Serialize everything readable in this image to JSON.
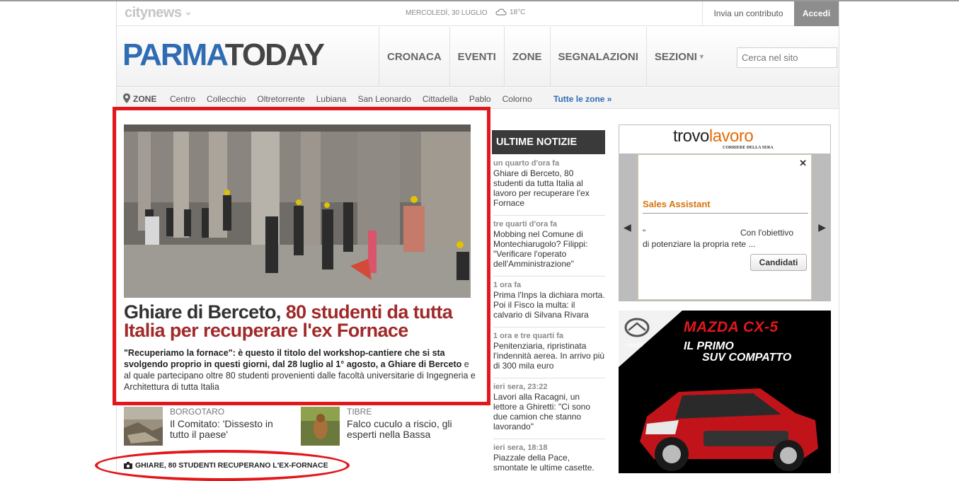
{
  "topbar": {
    "brand": "citynews",
    "date": "MERCOLEDÌ, 30 LUGLIO",
    "temperature": "18°C",
    "contribute_label": "Invia un contributo",
    "login_label": "Accedi"
  },
  "header": {
    "logo_part1": "PARMA",
    "logo_part2": "TODAY",
    "nav": [
      {
        "label": "CRONACA"
      },
      {
        "label": "EVENTI"
      },
      {
        "label": "ZONE"
      },
      {
        "label": "SEGNALAZIONI"
      },
      {
        "label": "SEZIONI"
      }
    ],
    "search_placeholder": "Cerca nel sito"
  },
  "zones": {
    "label": "ZONE",
    "items": [
      "Centro",
      "Collecchio",
      "Oltretorrente",
      "Lubiana",
      "San Leonardo",
      "Cittadella",
      "Pablo",
      "Colorno"
    ],
    "all_label": "Tutte le zone »"
  },
  "lead": {
    "headline_part1": "Ghiare di Berceto, ",
    "headline_part2": "80 studenti da tutta Italia per recuperare l'ex Fornace",
    "abstract_bold": "\"Recuperiamo la fornace\": è questo il titolo del workshop-cantiere che si sta svolgendo proprio in questi giorni, dal 28 luglio al 1° agosto, a Ghiare di Berceto",
    "abstract_rest": " e al quale partecipano oltre 80 studenti provenienti dalle facoltà universitarie di Ingegneria e Architettura di tutta Italia"
  },
  "stories": [
    {
      "category": "BORGOTARO",
      "title": "Il Comitato: 'Dissesto in tutto il paese'"
    },
    {
      "category": "TIBRE",
      "title": "Falco cuculo a riscio, gli esperti nella Bassa"
    }
  ],
  "gallery_caption": "GHIARE, 80 STUDENTI RECUPERANO L'EX-FORNACE",
  "latest": {
    "title": "ULTIME NOTIZIE",
    "items": [
      {
        "time": "un quarto d'ora fa",
        "title": "Ghiare di Berceto, 80 studenti da tutta Italia al lavoro per recuperare l'ex Fornace"
      },
      {
        "time": "tre quarti d'ora fa",
        "title": "Mobbing nel Comune di Montechiarugolo? Filippi: \"Verificare l'operato dell'Amministrazione\""
      },
      {
        "time": "1 ora fa",
        "title": "Prima l'Inps la dichiara morta. Poi il Fisco la multa: il calvario di Silvana Rivara"
      },
      {
        "time": "1 ora e tre quarti fa",
        "title": "Penitenziaria, ripristinata l'indennità aerea. In arrivo più di 300 mila euro"
      },
      {
        "time": "ieri sera, 23:22",
        "title": "Lavori alla Racagni, un lettore a Ghiretti: \"Ci sono due camion che stanno lavorando\""
      },
      {
        "time": "ieri sera, 18:18",
        "title": "Piazzale della Pace, smontate le ultime casette."
      }
    ]
  },
  "ad_trovolavoro": {
    "logo_part1": "trovo",
    "logo_part2": "lavoro",
    "sub": "CORRIERE DELLA SERA",
    "job_title": "Sales Assistant",
    "desc_line1_a": "\"",
    "desc_line1_b": "Con l'obiettivo",
    "desc_line2": "di potenziare la propria rete ...",
    "button_label": "Candidati"
  },
  "ad_mazda": {
    "title": "MAZDA CX-5",
    "line1": "IL PRIMO",
    "line2": "SUV COMPATTO",
    "brand": "mazda"
  }
}
